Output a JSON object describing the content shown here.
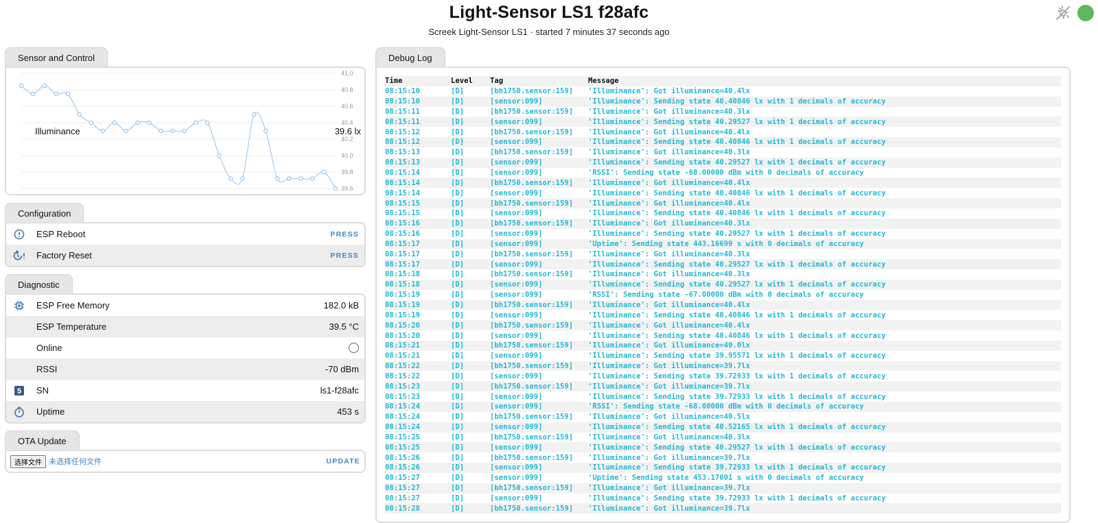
{
  "header": {
    "title": "Light-Sensor LS1 f28afc",
    "subtitle": "Screek Light-Sensor LS1 · started 7 minutes 37 seconds ago",
    "status_color": "#5cb85c"
  },
  "sensor_card": {
    "tab_label": "Sensor and Control",
    "illuminance_label": "Illuminance",
    "illuminance_value": "39.6 lx",
    "y_ticks": [
      "41.0",
      "40.8",
      "40.6",
      "40.4",
      "40.2",
      "40.0",
      "39.8",
      "39.6"
    ]
  },
  "chart_data": {
    "type": "line",
    "title": "",
    "xlabel": "",
    "ylabel": "",
    "ylim": [
      39.6,
      41.0
    ],
    "grid": true,
    "series": [
      {
        "values": [
          40.85,
          40.75,
          40.85,
          40.75,
          40.75,
          40.5,
          40.4,
          40.3,
          40.4,
          40.3,
          40.4,
          40.4,
          40.3,
          40.3,
          40.3,
          40.4,
          40.4,
          40.0,
          39.72,
          39.72,
          40.5,
          40.3,
          39.72,
          39.72,
          39.72,
          39.72,
          39.8,
          39.6
        ]
      }
    ]
  },
  "configuration": {
    "tab_label": "Configuration",
    "rows": [
      {
        "label": "ESP Reboot",
        "action": "PRESS",
        "icon": "restart-icon"
      },
      {
        "label": "Factory Reset",
        "action": "PRESS",
        "icon": "factory-reset-icon"
      }
    ]
  },
  "diagnostic": {
    "tab_label": "Diagnostic",
    "rows": [
      {
        "label": "ESP Free Memory",
        "value": "182.0 kB",
        "icon": "chip-icon"
      },
      {
        "label": "ESP Temperature",
        "value": "39.5 °C",
        "icon": ""
      },
      {
        "label": "Online",
        "value": "",
        "icon": ""
      },
      {
        "label": "RSSI",
        "value": "-70 dBm",
        "icon": ""
      },
      {
        "label": "SN",
        "value": "ls1-f28afc",
        "icon": "serial-number-icon"
      },
      {
        "label": "Uptime",
        "value": "453 s",
        "icon": "timer-icon"
      }
    ]
  },
  "ota": {
    "tab_label": "OTA Update",
    "choose_file": "选择文件",
    "no_file": "未选择任何文件",
    "update": "UPDATE"
  },
  "debug_log": {
    "tab_label": "Debug Log",
    "columns": [
      "Time",
      "Level",
      "Tag",
      "Message"
    ],
    "entries": [
      [
        "08:15:10",
        "[D]",
        "[bh1750.sensor:159]",
        "'Illuminance': Got illuminance=40.4lx"
      ],
      [
        "08:15:10",
        "[D]",
        "[sensor:099]",
        "'Illuminance': Sending state 40.40846 lx with 1 decimals of accuracy"
      ],
      [
        "08:15:11",
        "[D]",
        "[bh1750.sensor:159]",
        "'Illuminance': Got illuminance=40.3lx"
      ],
      [
        "08:15:11",
        "[D]",
        "[sensor:099]",
        "'Illuminance': Sending state 40.29527 lx with 1 decimals of accuracy"
      ],
      [
        "08:15:12",
        "[D]",
        "[bh1750.sensor:159]",
        "'Illuminance': Got illuminance=40.4lx"
      ],
      [
        "08:15:12",
        "[D]",
        "[sensor:099]",
        "'Illuminance': Sending state 40.40846 lx with 1 decimals of accuracy"
      ],
      [
        "08:15:13",
        "[D]",
        "[bh1750.sensor:159]",
        "'Illuminance': Got illuminance=40.3lx"
      ],
      [
        "08:15:13",
        "[D]",
        "[sensor:099]",
        "'Illuminance': Sending state 40.29527 lx with 1 decimals of accuracy"
      ],
      [
        "08:15:14",
        "[D]",
        "[sensor:099]",
        "'RSSI': Sending state -68.00000 dBm with 0 decimals of accuracy"
      ],
      [
        "08:15:14",
        "[D]",
        "[bh1750.sensor:159]",
        "'Illuminance': Got illuminance=40.4lx"
      ],
      [
        "08:15:14",
        "[D]",
        "[sensor:099]",
        "'Illuminance': Sending state 40.40846 lx with 1 decimals of accuracy"
      ],
      [
        "08:15:15",
        "[D]",
        "[bh1750.sensor:159]",
        "'Illuminance': Got illuminance=40.4lx"
      ],
      [
        "08:15:15",
        "[D]",
        "[sensor:099]",
        "'Illuminance': Sending state 40.40846 lx with 1 decimals of accuracy"
      ],
      [
        "08:15:16",
        "[D]",
        "[bh1750.sensor:159]",
        "'Illuminance': Got illuminance=40.3lx"
      ],
      [
        "08:15:16",
        "[D]",
        "[sensor:099]",
        "'Illuminance': Sending state 40.29527 lx with 1 decimals of accuracy"
      ],
      [
        "08:15:17",
        "[D]",
        "[sensor:099]",
        "'Uptime': Sending state 443.16699 s with 0 decimals of accuracy"
      ],
      [
        "08:15:17",
        "[D]",
        "[bh1750.sensor:159]",
        "'Illuminance': Got illuminance=40.3lx"
      ],
      [
        "08:15:17",
        "[D]",
        "[sensor:099]",
        "'Illuminance': Sending state 40.29527 lx with 1 decimals of accuracy"
      ],
      [
        "08:15:18",
        "[D]",
        "[bh1750.sensor:159]",
        "'Illuminance': Got illuminance=40.3lx"
      ],
      [
        "08:15:18",
        "[D]",
        "[sensor:099]",
        "'Illuminance': Sending state 40.29527 lx with 1 decimals of accuracy"
      ],
      [
        "08:15:19",
        "[D]",
        "[sensor:099]",
        "'RSSI': Sending state -67.00000 dBm with 0 decimals of accuracy"
      ],
      [
        "08:15:19",
        "[D]",
        "[bh1750.sensor:159]",
        "'Illuminance': Got illuminance=40.4lx"
      ],
      [
        "08:15:19",
        "[D]",
        "[sensor:099]",
        "'Illuminance': Sending state 40.40846 lx with 1 decimals of accuracy"
      ],
      [
        "08:15:20",
        "[D]",
        "[bh1750.sensor:159]",
        "'Illuminance': Got illuminance=40.4lx"
      ],
      [
        "08:15:20",
        "[D]",
        "[sensor:099]",
        "'Illuminance': Sending state 40.40846 lx with 1 decimals of accuracy"
      ],
      [
        "08:15:21",
        "[D]",
        "[bh1750.sensor:159]",
        "'Illuminance': Got illuminance=40.0lx"
      ],
      [
        "08:15:21",
        "[D]",
        "[sensor:099]",
        "'Illuminance': Sending state 39.95571 lx with 1 decimals of accuracy"
      ],
      [
        "08:15:22",
        "[D]",
        "[bh1750.sensor:159]",
        "'Illuminance': Got illuminance=39.7lx"
      ],
      [
        "08:15:22",
        "[D]",
        "[sensor:099]",
        "'Illuminance': Sending state 39.72933 lx with 1 decimals of accuracy"
      ],
      [
        "08:15:23",
        "[D]",
        "[bh1750.sensor:159]",
        "'Illuminance': Got illuminance=39.7lx"
      ],
      [
        "08:15:23",
        "[D]",
        "[sensor:099]",
        "'Illuminance': Sending state 39.72933 lx with 1 decimals of accuracy"
      ],
      [
        "08:15:24",
        "[D]",
        "[sensor:099]",
        "'RSSI': Sending state -68.00000 dBm with 0 decimals of accuracy"
      ],
      [
        "08:15:24",
        "[D]",
        "[bh1750.sensor:159]",
        "'Illuminance': Got illuminance=40.5lx"
      ],
      [
        "08:15:24",
        "[D]",
        "[sensor:099]",
        "'Illuminance': Sending state 40.52165 lx with 1 decimals of accuracy"
      ],
      [
        "08:15:25",
        "[D]",
        "[bh1750.sensor:159]",
        "'Illuminance': Got illuminance=40.3lx"
      ],
      [
        "08:15:25",
        "[D]",
        "[sensor:099]",
        "'Illuminance': Sending state 40.29527 lx with 1 decimals of accuracy"
      ],
      [
        "08:15:26",
        "[D]",
        "[bh1750.sensor:159]",
        "'Illuminance': Got illuminance=39.7lx"
      ],
      [
        "08:15:26",
        "[D]",
        "[sensor:099]",
        "'Illuminance': Sending state 39.72933 lx with 1 decimals of accuracy"
      ],
      [
        "08:15:27",
        "[D]",
        "[sensor:099]",
        "'Uptime': Sending state 453.17001 s with 0 decimals of accuracy"
      ],
      [
        "08:15:27",
        "[D]",
        "[bh1750.sensor:159]",
        "'Illuminance': Got illuminance=39.7lx"
      ],
      [
        "08:15:27",
        "[D]",
        "[sensor:099]",
        "'Illuminance': Sending state 39.72933 lx with 1 decimals of accuracy"
      ],
      [
        "08:15:28",
        "[D]",
        "[bh1750.sensor:159]",
        "'Illuminance': Got illuminance=39.7lx"
      ]
    ]
  }
}
